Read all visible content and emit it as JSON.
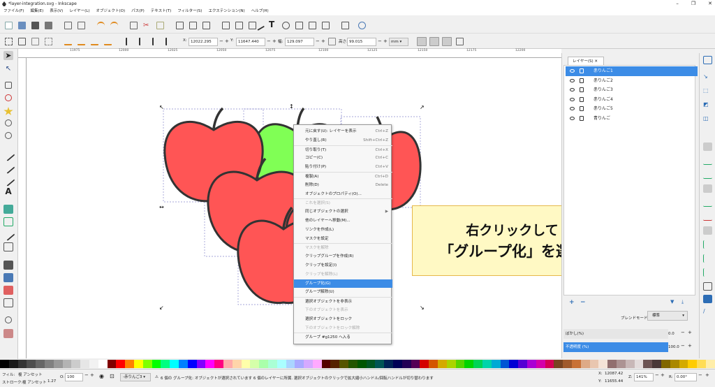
{
  "window": {
    "title": "*layer-integration.svg - Inkscape",
    "controls": [
      "–",
      "❐",
      "✕"
    ]
  },
  "menubar": [
    "ファイル(F)",
    "編集(E)",
    "表示(V)",
    "レイヤー(L)",
    "オブジェクト(O)",
    "パス(P)",
    "テキスト(T)",
    "フィルター(S)",
    "エクステンション(N)",
    "ヘルプ(H)"
  ],
  "controls": {
    "x_label": "X:",
    "x_value": "12022.295",
    "y_label": "Y:",
    "y_value": "11647.440",
    "w_label": "幅:",
    "w_value": "129.097",
    "h_label": "高さ:",
    "h_value": "99.015",
    "unit": "mm"
  },
  "ruler_ticks": [
    "11975",
    "12000",
    "12025",
    "12050",
    "12075",
    "12100",
    "12125",
    "12150",
    "12175",
    "12200"
  ],
  "context_menu": {
    "items": [
      {
        "label": "元に戻す(U): レイヤーを表示",
        "shortcut": "Ctrl+Z",
        "disabled": false
      },
      {
        "label": "やり直し(R)",
        "shortcut": "Shift+Ctrl+Z",
        "disabled": false
      },
      {
        "label": "切り取り(T)",
        "shortcut": "Ctrl+X",
        "disabled": false
      },
      {
        "label": "コピー(C)",
        "shortcut": "Ctrl+C",
        "disabled": false
      },
      {
        "label": "貼り付け(P)",
        "shortcut": "Ctrl+V",
        "disabled": false
      },
      {
        "label": "複製(A)",
        "shortcut": "Ctrl+D",
        "disabled": false
      },
      {
        "label": "削除(D)",
        "shortcut": "Delete",
        "disabled": false
      },
      {
        "label": "オブジェクトのプロパティ(O)...",
        "shortcut": "",
        "disabled": false
      },
      {
        "label": "これを選択(S)",
        "shortcut": "",
        "disabled": true
      },
      {
        "label": "同じオブジェクトの選択",
        "shortcut": "▶",
        "disabled": false
      },
      {
        "label": "他のレイヤーへ移動(M)...",
        "shortcut": "",
        "disabled": false
      },
      {
        "label": "リンクを作成(L)",
        "shortcut": "",
        "disabled": false
      },
      {
        "label": "マスクを設定",
        "shortcut": "",
        "disabled": false
      },
      {
        "label": "マスクを解除",
        "shortcut": "",
        "disabled": true
      },
      {
        "label": "クリップグループを作成(R)",
        "shortcut": "",
        "disabled": false
      },
      {
        "label": "クリップを設定(I)",
        "shortcut": "",
        "disabled": false
      },
      {
        "label": "クリップを解除(L)",
        "shortcut": "",
        "disabled": true
      },
      {
        "label": "グループ化(G)",
        "shortcut": "",
        "disabled": false,
        "highlighted": true
      },
      {
        "label": "グループ解除(U)",
        "shortcut": "",
        "disabled": false
      },
      {
        "label": "選択オブジェクトを非表示",
        "shortcut": "",
        "disabled": false
      },
      {
        "label": "下のオブジェクトを表示",
        "shortcut": "",
        "disabled": true
      },
      {
        "label": "選択オブジェクトをロック",
        "shortcut": "",
        "disabled": false
      },
      {
        "label": "下のオブジェクトをロック解除",
        "shortcut": "",
        "disabled": true
      },
      {
        "label": "グループ #g1250 へ入る",
        "shortcut": "",
        "disabled": false
      }
    ]
  },
  "callout": {
    "line1": "右クリックして",
    "line2": "「グループ化」を選択"
  },
  "layers_panel": {
    "tab_label": "レイヤー(S)",
    "layers": [
      "赤りんご1",
      "赤りんご2",
      "赤りんご3",
      "赤りんご4",
      "赤りんご5",
      "青りんご"
    ],
    "selected_index": 0,
    "blend_label": "ブレンドモード:",
    "blend_value": "標準",
    "blur_label": "ぼかし(%)",
    "blur_value": "0.0",
    "opacity_label": "不透明度 (%)",
    "opacity_value": "100.0"
  },
  "statusbar": {
    "fill_label": "フィル:",
    "fill_value": "複 アンセット",
    "stroke_label": "ストローク:",
    "stroke_value": "複 アンセット",
    "stroke_width": "1.27",
    "opacity_label": "O:",
    "opacity_value": "100",
    "layer_select": "-赤りんご3",
    "message": "6 個の グループ化: オブジェクトが選択されています 6 個のレイヤーに所属. 選択オブジェクトのクリックで拡大縮小ハンドル/回転ハンドルが切り替わります",
    "x_label": "X:",
    "x_value": "12087.42",
    "y_label": "Y:",
    "y_value": "11655.44",
    "zoom_label": "Z:",
    "zoom_value": "141%",
    "rot_label": "R:",
    "rot_value": "0.00°"
  },
  "colors": {
    "accent": "#3c8ce6",
    "apple_red": "#ff5555",
    "apple_green": "#80ff55",
    "callout_bg": "#fff9c4",
    "callout_border": "#f0c040"
  }
}
